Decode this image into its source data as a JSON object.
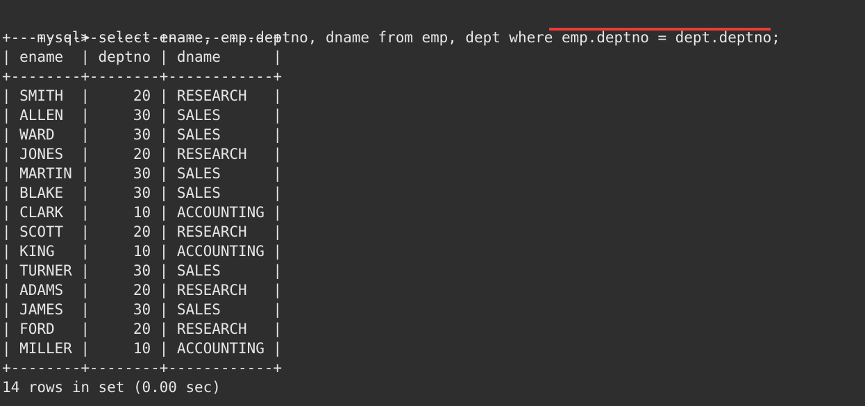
{
  "terminal": {
    "background_color": "#2e2e2e",
    "text_color": "#e6e6e6",
    "highlight_color": "#ef3b37",
    "prompt": "mysql> ",
    "query": "select ename, emp.deptno, dname from emp, dept where emp.deptno = dept.deptno;",
    "prompt_line": "mysql> select ename, emp.deptno, dname from emp, dept where emp.deptno = dept.deptno;",
    "underlined_fragment": "emp.deptno = dept.deptno;",
    "border_rule": "+--------+--------+------------+",
    "header_row": "| ename  | deptno | dname      |",
    "rows": [
      "| SMITH  |     20 | RESEARCH   |",
      "| ALLEN  |     30 | SALES      |",
      "| WARD   |     30 | SALES      |",
      "| JONES  |     20 | RESEARCH   |",
      "| MARTIN |     30 | SALES      |",
      "| BLAKE  |     30 | SALES      |",
      "| CLARK  |     10 | ACCOUNTING |",
      "| SCOTT  |     20 | RESEARCH   |",
      "| KING   |     10 | ACCOUNTING |",
      "| TURNER |     30 | SALES      |",
      "| ADAMS  |     20 | RESEARCH   |",
      "| JAMES  |     30 | SALES      |",
      "| FORD   |     20 | RESEARCH   |",
      "| MILLER |     10 | ACCOUNTING |"
    ],
    "result_status": "14 rows in set (0.00 sec)",
    "table": {
      "columns": [
        "ename",
        "deptno",
        "dname"
      ],
      "records": [
        {
          "ename": "SMITH",
          "deptno": "20",
          "dname": "RESEARCH"
        },
        {
          "ename": "ALLEN",
          "deptno": "30",
          "dname": "SALES"
        },
        {
          "ename": "WARD",
          "deptno": "30",
          "dname": "SALES"
        },
        {
          "ename": "JONES",
          "deptno": "20",
          "dname": "RESEARCH"
        },
        {
          "ename": "MARTIN",
          "deptno": "30",
          "dname": "SALES"
        },
        {
          "ename": "BLAKE",
          "deptno": "30",
          "dname": "SALES"
        },
        {
          "ename": "CLARK",
          "deptno": "10",
          "dname": "ACCOUNTING"
        },
        {
          "ename": "SCOTT",
          "deptno": "20",
          "dname": "RESEARCH"
        },
        {
          "ename": "KING",
          "deptno": "10",
          "dname": "ACCOUNTING"
        },
        {
          "ename": "TURNER",
          "deptno": "30",
          "dname": "SALES"
        },
        {
          "ename": "ADAMS",
          "deptno": "20",
          "dname": "RESEARCH"
        },
        {
          "ename": "JAMES",
          "deptno": "30",
          "dname": "SALES"
        },
        {
          "ename": "FORD",
          "deptno": "20",
          "dname": "RESEARCH"
        },
        {
          "ename": "MILLER",
          "deptno": "10",
          "dname": "ACCOUNTING"
        }
      ],
      "row_count": 14,
      "elapsed_seconds": "0.00"
    }
  }
}
